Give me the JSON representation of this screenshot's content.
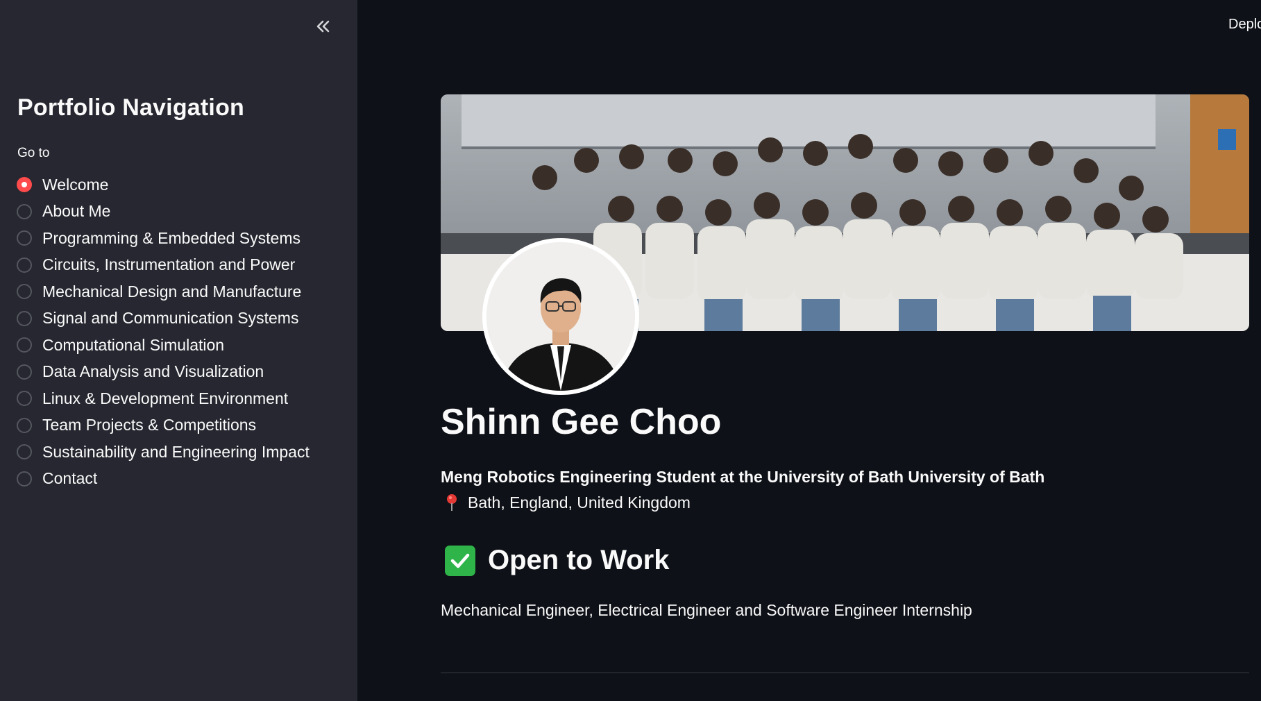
{
  "header": {
    "deploy_label": "Deplo"
  },
  "sidebar": {
    "collapse_icon": "double-chevron-left-icon",
    "title": "Portfolio Navigation",
    "goto_label": "Go to",
    "selected_index": 0,
    "items": [
      {
        "label": "Welcome"
      },
      {
        "label": "About Me"
      },
      {
        "label": "Programming & Embedded Systems"
      },
      {
        "label": "Circuits, Instrumentation and Power"
      },
      {
        "label": "Mechanical Design and Manufacture"
      },
      {
        "label": "Signal and Communication Systems"
      },
      {
        "label": "Computational Simulation"
      },
      {
        "label": "Data Analysis and Visualization"
      },
      {
        "label": "Linux & Development Environment"
      },
      {
        "label": "Team Projects & Competitions"
      },
      {
        "label": "Sustainability and Engineering Impact"
      },
      {
        "label": "Contact"
      }
    ]
  },
  "main": {
    "name": "Shinn Gee Choo",
    "subtitle": "Meng Robotics Engineering Student at the University of Bath University of Bath",
    "location_icon": "pin-icon",
    "location": "Bath, England, United Kingdom",
    "status_icon": "check-mark-icon",
    "status": "Open to Work",
    "roles": "Mechanical Engineer, Electrical Engineer and Software Engineer Internship"
  },
  "colors": {
    "background": "#0e1117",
    "sidebar": "#262730",
    "accent": "#ff4b4b",
    "text": "#fafafa",
    "check_green": "#2fb44a"
  }
}
